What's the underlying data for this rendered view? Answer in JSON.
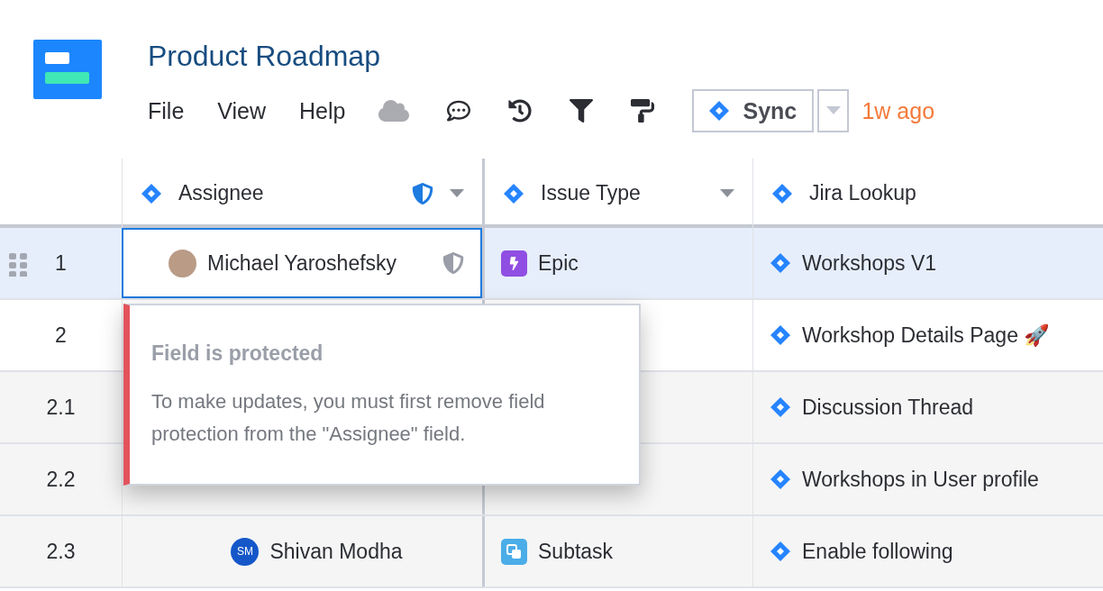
{
  "document": {
    "title": "Product Roadmap"
  },
  "menu": [
    {
      "label": "File"
    },
    {
      "label": "View"
    },
    {
      "label": "Help"
    }
  ],
  "sync": {
    "label": "Sync",
    "last_synced": "1w ago"
  },
  "columns": [
    {
      "label": "Assignee",
      "protected": true,
      "dropdown": true
    },
    {
      "label": "Issue Type",
      "protected": false,
      "dropdown": true
    },
    {
      "label": "Jira Lookup",
      "protected": false,
      "dropdown": false
    }
  ],
  "rows": [
    {
      "number": "1",
      "selected": true,
      "assignee": {
        "name": "Michael Yaroshefsky",
        "kind": "photo",
        "protected": true,
        "selected": true
      },
      "issue_type": {
        "label": "Epic",
        "kind": "epic"
      },
      "lookup": "Workshops V1",
      "children": []
    },
    {
      "number": "2",
      "selected": false,
      "lookup": "Workshop Details Page 🚀",
      "children": [
        {
          "number": "2.1",
          "selected": false,
          "lookup": "Discussion Thread"
        },
        {
          "number": "2.2",
          "selected": false,
          "lookup": "Workshops in User profile"
        },
        {
          "number": "2.3",
          "selected": false,
          "assignee": {
            "name": "Shivan Modha",
            "kind": "initials",
            "initials": "SM",
            "protected": false,
            "selected": false
          },
          "issue_type": {
            "label": "Subtask",
            "kind": "subtask"
          },
          "lookup": "Enable following"
        }
      ]
    }
  ],
  "popover": {
    "title": "Field is protected",
    "message": "To make updates, you must first remove field protection from the \"Assignee\" field."
  }
}
